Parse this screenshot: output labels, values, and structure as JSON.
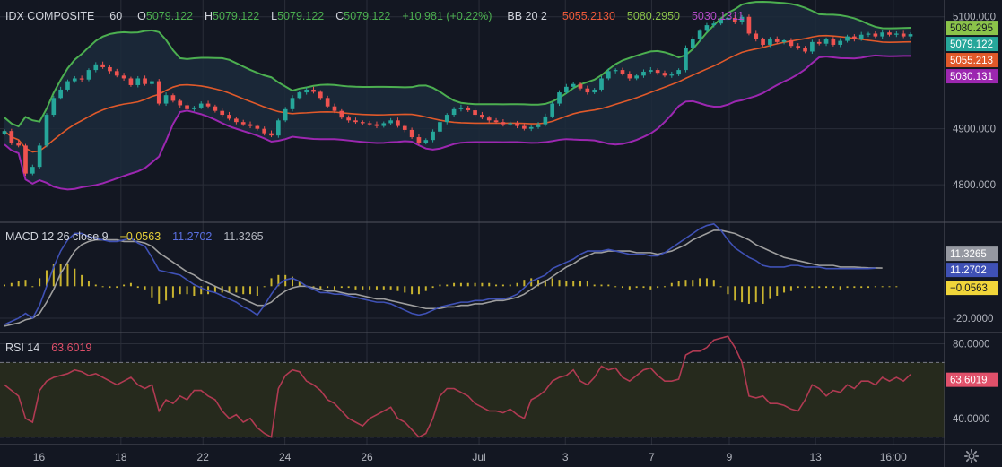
{
  "header": {
    "symbol": "IDX COMPOSITE",
    "interval": "60",
    "o_label": "O",
    "o_value": "5079.122",
    "h_label": "H",
    "h_value": "5079.122",
    "l_label": "L",
    "l_value": "5079.122",
    "c_label": "C",
    "c_value": "5079.122",
    "change": "+10.981 (+0.22%)",
    "bb_label": "BB 20 2",
    "bb_basis": "5055.2130",
    "bb_upper": "5080.2950",
    "bb_lower": "5030.1311"
  },
  "macd_header": {
    "label": "MACD 12 26 close 9",
    "hist": "−0.0563",
    "macd": "11.2702",
    "signal": "11.3265"
  },
  "rsi_header": {
    "label": "RSI 14",
    "value": "63.6019"
  },
  "colors": {
    "bg": "#131722",
    "grid": "#2a2e39",
    "up": "#26a69a",
    "down": "#ef5350",
    "bb_upper": "#4caf50",
    "bb_basis": "#e0592a",
    "bb_lower": "#9c27b0",
    "macd": "#3f51b5",
    "signal": "#9e9e9e",
    "hist": "#c9b42f",
    "rsi": "#b03a52",
    "rsi_band": "#262a1d"
  },
  "chart_data": [
    {
      "type": "candlestick",
      "title": "IDX COMPOSITE",
      "interval": "60",
      "x_ticks": [
        "16",
        "18",
        "22",
        "24",
        "26",
        "Jul",
        "3",
        "7",
        "9",
        "13",
        "16:00"
      ],
      "y_ticks": [
        "5100.000",
        "4900.000",
        "4800.000"
      ],
      "ylim": [
        4733,
        5130
      ],
      "close": [
        4896,
        4875,
        4870,
        4820,
        4832,
        4870,
        4925,
        4955,
        4970,
        4985,
        4990,
        4988,
        5005,
        5015,
        5010,
        5003,
        4995,
        4990,
        4978,
        4990,
        4980,
        4985,
        4945,
        4960,
        4950,
        4942,
        4935,
        4938,
        4945,
        4940,
        4932,
        4925,
        4918,
        4912,
        4908,
        4905,
        4900,
        4892,
        4888,
        4915,
        4935,
        4955,
        4965,
        4970,
        4966,
        4955,
        4940,
        4932,
        4920,
        4915,
        4912,
        4910,
        4908,
        4905,
        4910,
        4915,
        4905,
        4898,
        4885,
        4875,
        4880,
        4895,
        4912,
        4925,
        4935,
        4938,
        4933,
        4925,
        4920,
        4915,
        4912,
        4908,
        4910,
        4905,
        4900,
        4903,
        4908,
        4922,
        4945,
        4965,
        4975,
        4980,
        4972,
        4965,
        4970,
        4990,
        5003,
        5005,
        4998,
        4990,
        4995,
        5002,
        5005,
        5000,
        4995,
        4997,
        5005,
        5045,
        5060,
        5075,
        5085,
        5088,
        5095,
        5098,
        5090,
        5100,
        5070,
        5060,
        5050,
        5060,
        5055,
        5058,
        5048,
        5045,
        5038,
        5055,
        5052,
        5060,
        5050,
        5057,
        5065,
        5060,
        5068,
        5070,
        5065,
        5072,
        5068,
        5070,
        5065,
        5069
      ],
      "bb_upper": "5080.2950",
      "bb_basis": "5055.2130",
      "bb_lower": "5030.1311",
      "last_close": "5079.122"
    },
    {
      "type": "line",
      "title": "MACD 12 26 close 9",
      "y_ticks": [
        "-20.0000"
      ],
      "ylim": [
        -29,
        40
      ],
      "series": [
        {
          "name": "MACD",
          "values": [
            -24,
            -22,
            -20,
            -17,
            -20,
            -12,
            0,
            12,
            22,
            29,
            33,
            33,
            31,
            30,
            29,
            28,
            28,
            29,
            30,
            27,
            25,
            18,
            10,
            9,
            8,
            7,
            4,
            1,
            -1,
            -3,
            -4,
            -6,
            -8,
            -10,
            -13,
            -15,
            -18,
            -12,
            -5,
            1,
            4,
            5,
            3,
            0,
            -2,
            -4,
            -4,
            -5,
            -5,
            -6,
            -7,
            -8,
            -9,
            -10,
            -10,
            -11,
            -13,
            -15,
            -17,
            -18,
            -17,
            -15,
            -13,
            -12,
            -11,
            -10,
            -10,
            -9,
            -9,
            -8,
            -8,
            -8,
            -7,
            -5,
            -1,
            3,
            5,
            7,
            11,
            13,
            15,
            17,
            20,
            22,
            22,
            22,
            23,
            22,
            21,
            20,
            20,
            20,
            19,
            19,
            21,
            24,
            27,
            30,
            33,
            36,
            38,
            39,
            35,
            29,
            24,
            21,
            18,
            16,
            13,
            12,
            12,
            12,
            13,
            13,
            12,
            12,
            12,
            11,
            11,
            11,
            11,
            11,
            11,
            11,
            11.27
          ]
        },
        {
          "name": "Signal",
          "values": [
            -25,
            -24,
            -23,
            -21,
            -20,
            -17,
            -10,
            -2,
            8,
            15,
            22,
            26,
            28,
            29,
            29,
            29,
            29,
            28,
            28,
            28,
            27,
            25,
            21,
            18,
            15,
            12,
            9,
            7,
            4,
            2,
            0,
            -2,
            -4,
            -6,
            -8,
            -10,
            -12,
            -12,
            -10,
            -6,
            -3,
            -1,
            0,
            0,
            -1,
            -2,
            -3,
            -3,
            -4,
            -5,
            -5,
            -6,
            -7,
            -8,
            -8,
            -9,
            -10,
            -11,
            -12,
            -13,
            -14,
            -14,
            -14,
            -13,
            -13,
            -12,
            -12,
            -11,
            -11,
            -10,
            -9,
            -9,
            -8,
            -7,
            -5,
            -2,
            1,
            3,
            6,
            9,
            12,
            14,
            17,
            19,
            21,
            21,
            22,
            22,
            22,
            22,
            21,
            21,
            21,
            20,
            21,
            22,
            24,
            26,
            29,
            31,
            33,
            35,
            35,
            34,
            33,
            31,
            29,
            26,
            24,
            22,
            20,
            18,
            17,
            16,
            15,
            14,
            13,
            13,
            13,
            12,
            12,
            12,
            11.7,
            11.5,
            11.4,
            11.33
          ]
        },
        {
          "name": "Histogram",
          "values": [
            1,
            2,
            3,
            4,
            0,
            5,
            10,
            14,
            14,
            14,
            11,
            7,
            3,
            1,
            0,
            -1,
            -1,
            1,
            2,
            -1,
            -2,
            -7,
            -11,
            -9,
            -7,
            -5,
            -5,
            -6,
            -5,
            -5,
            -4,
            -4,
            -4,
            -4,
            -5,
            -5,
            -6,
            0,
            5,
            7,
            7,
            6,
            3,
            0,
            -1,
            -2,
            -1,
            -2,
            -1,
            -1,
            -2,
            -2,
            -2,
            -2,
            -2,
            -2,
            -3,
            -4,
            -5,
            -5,
            -3,
            -1,
            1,
            1,
            2,
            2,
            2,
            2,
            2,
            2,
            1,
            1,
            1,
            2,
            4,
            5,
            4,
            4,
            5,
            4,
            3,
            3,
            3,
            3,
            1,
            1,
            1,
            0,
            -1,
            -2,
            -1,
            -1,
            -2,
            -1,
            0,
            2,
            3,
            4,
            4,
            5,
            5,
            4,
            0,
            -5,
            -9,
            -10,
            -11,
            -10,
            -11,
            -8,
            -6,
            -4,
            -3,
            -1,
            -1,
            -1,
            -1,
            -1,
            -1,
            -2,
            -1,
            -1,
            -1,
            -1,
            -0.4,
            -0.2,
            -0.1,
            -0.06
          ]
        }
      ]
    },
    {
      "type": "line",
      "title": "RSI 14",
      "y_ticks": [
        "80.0000",
        "40.0000"
      ],
      "ylim": [
        26,
        86
      ],
      "bands": [
        70,
        30
      ],
      "series": [
        {
          "name": "RSI",
          "values": [
            58,
            55,
            52,
            40,
            38,
            55,
            60,
            62,
            63,
            64,
            66,
            65,
            63,
            64,
            62,
            60,
            58,
            60,
            62,
            58,
            56,
            58,
            44,
            50,
            48,
            52,
            50,
            55,
            55,
            52,
            50,
            44,
            40,
            42,
            38,
            40,
            35,
            32,
            30,
            56,
            63,
            66,
            65,
            60,
            58,
            55,
            50,
            48,
            44,
            40,
            38,
            36,
            40,
            42,
            44,
            46,
            40,
            38,
            34,
            30,
            32,
            40,
            52,
            56,
            56,
            54,
            52,
            48,
            46,
            44,
            44,
            43,
            45,
            42,
            40,
            50,
            52,
            55,
            60,
            62,
            63,
            66,
            60,
            58,
            62,
            68,
            66,
            67,
            62,
            60,
            63,
            66,
            67,
            63,
            60,
            60,
            61,
            74,
            76,
            76,
            78,
            82,
            83,
            84,
            78,
            70,
            52,
            51,
            52,
            48,
            48,
            47,
            45,
            44,
            50,
            58,
            56,
            52,
            55,
            54,
            58,
            56,
            60,
            60,
            58,
            62,
            60,
            62,
            60,
            63.6
          ]
        }
      ]
    }
  ]
}
